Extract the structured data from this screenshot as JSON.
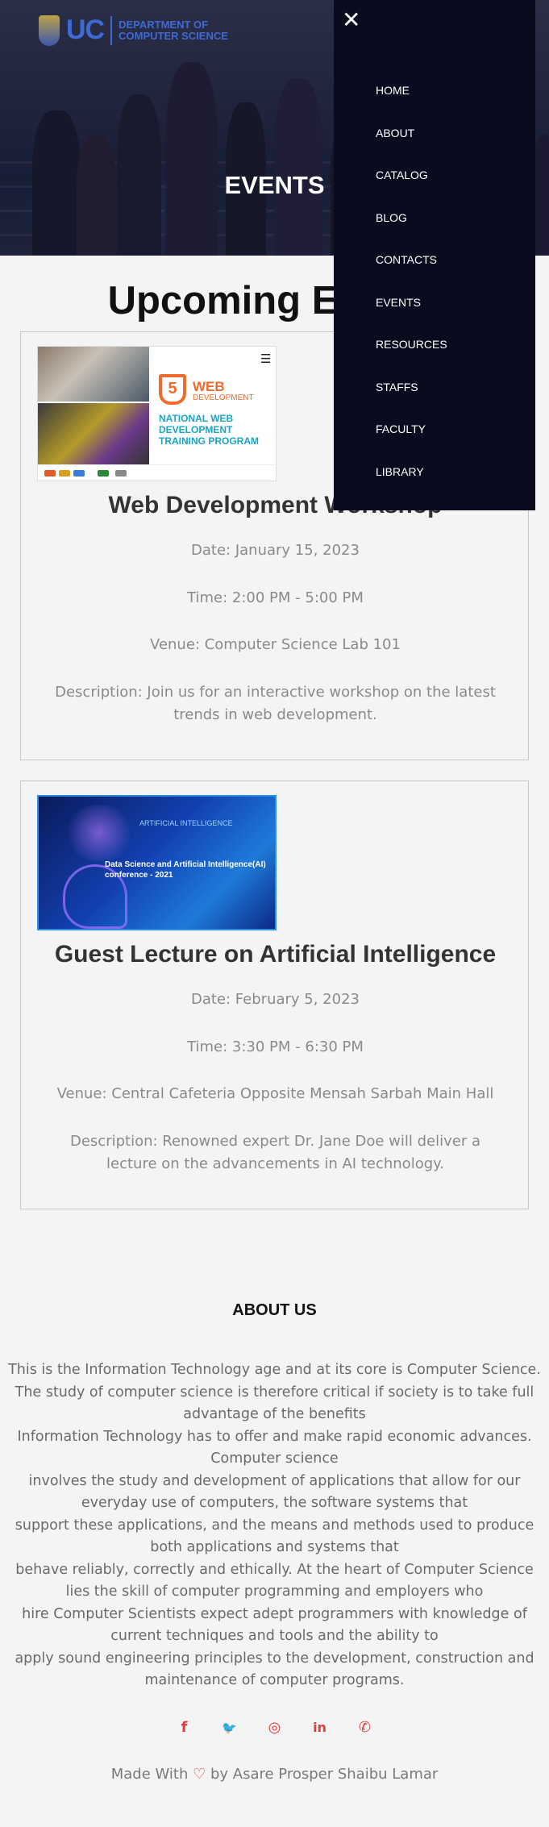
{
  "header": {
    "logo_abbr": "UC",
    "logo_dept_line1": "DEPARTMENT OF",
    "logo_dept_line2": "COMPUTER SCIENCE",
    "page_title": "EVENTS"
  },
  "nav": {
    "close_glyph": "✕",
    "items": [
      "HOME",
      "ABOUT",
      "CATALOG",
      "BLOG",
      "CONTACTS",
      "EVENTS",
      "RESOURCES",
      "STAFFS",
      "FACULTY",
      "LIBRARY"
    ]
  },
  "section": {
    "title": "Upcoming Events"
  },
  "events": [
    {
      "title": "Web Development Workshop",
      "date": "Date: January 15, 2023",
      "time": "Time: 2:00 PM - 5:00 PM",
      "venue": "Venue: Computer Science Lab 101",
      "description": "Description: Join us for an interactive workshop on the latest trends in web development.",
      "image": {
        "heading": "WEB",
        "sub": "DEVELOPMENT",
        "program": "NATIONAL WEB DEVELOPMENT TRAINING PROGRAM"
      }
    },
    {
      "title": "Guest Lecture on Artificial Intelligence",
      "date": "Date: February 5, 2023",
      "time": "Time: 3:30 PM - 6:30 PM",
      "venue": "Venue: Central Cafeteria Opposite Mensah Sarbah Main Hall",
      "description": "Description: Renowned expert Dr. Jane Doe will deliver a lecture on the advancements in AI technology.",
      "image": {
        "label": "ARTIFICIAL INTELLIGENCE",
        "caption": "Data Science and Artificial Intelligence(AI) conference - 2021"
      }
    }
  ],
  "about": {
    "title": "ABOUT US",
    "lines": [
      "This is the Information Technology age and at its core is Computer Science. The study of computer science is therefore critical if society is to take full advantage of the benefits",
      "Information Technology has to offer and make rapid economic advances. Computer science",
      "involves the study and development of applications that allow for our everyday use of computers, the software systems that",
      "support these applications, and the means and methods used to produce both applications and systems that",
      "behave reliably, correctly and ethically. At the heart of Computer Science lies the skill of computer programming and employers who",
      "hire Computer Scientists expect adept programmers with knowledge of current techniques and tools and the ability to",
      "apply sound engineering principles to the development, construction and maintenance of computer programs."
    ]
  },
  "social": [
    {
      "icon": "facebook-icon",
      "glyph": "f"
    },
    {
      "icon": "twitter-icon",
      "glyph": "🐦"
    },
    {
      "icon": "instagram-icon",
      "glyph": "◎"
    },
    {
      "icon": "linkedin-icon",
      "glyph": "in"
    },
    {
      "icon": "whatsapp-icon",
      "glyph": "✆"
    }
  ],
  "footer": {
    "made_with": "Made With",
    "heart": "♡",
    "by": "by Asare Prosper Shaibu Lamar"
  },
  "colors": {
    "nav_bg": "#0b0b1f",
    "accent": "#e23b3b",
    "text_muted": "#8a8a8a"
  }
}
